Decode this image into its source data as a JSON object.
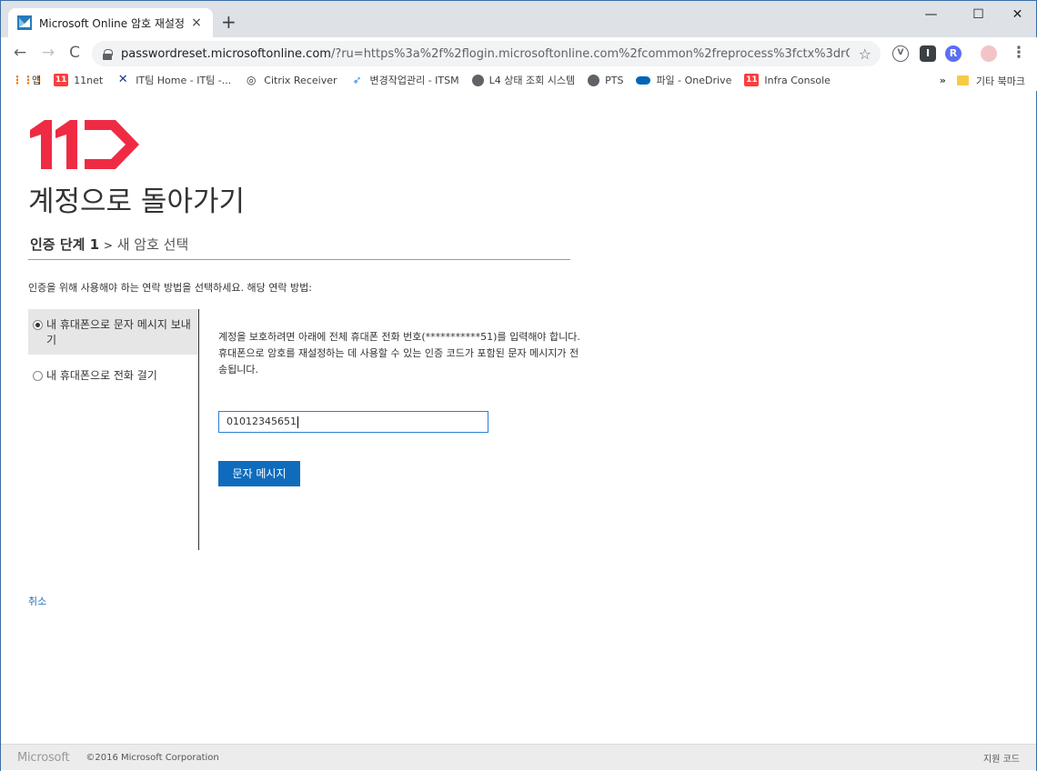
{
  "browser": {
    "tab_title": "Microsoft Online 암호 재설정",
    "tab_close": "×",
    "new_tab": "+",
    "window": {
      "minimize": "—",
      "maximize": "☐",
      "close": "✕"
    },
    "nav": {
      "back": "←",
      "forward": "→",
      "reload": "C"
    },
    "url_host": "passwordreset.microsoftonline.com",
    "url_rest": "/?ru=https%3a%2f%2flogin.microsoftonline.com%2fcommon%2freprocess%3fctx%3drQIIAeNisNLJ...",
    "star": "☆",
    "extensions": [
      "V",
      "I",
      "R"
    ],
    "menu": "⋮",
    "bookmarks": [
      {
        "label": "앱",
        "icon": "apps-grid-icon",
        "color": "#e8710a"
      },
      {
        "label": "11net",
        "icon": "11st-icon",
        "color": "#ff3d3d"
      },
      {
        "label": "IT팀 Home - IT팀 -...",
        "icon": "x-icon",
        "color": "#1a3a8a"
      },
      {
        "label": "Citrix Receiver",
        "icon": "citrix-icon",
        "color": "#333333"
      },
      {
        "label": "변경작업관리 - ITSM",
        "icon": "jira-icon",
        "color": "#2684ff"
      },
      {
        "label": "L4 상태 조회 시스템",
        "icon": "globe-icon",
        "color": "#5f6368"
      },
      {
        "label": "PTS",
        "icon": "globe-icon",
        "color": "#5f6368"
      },
      {
        "label": "파일 - OneDrive",
        "icon": "onedrive-icon",
        "color": "#0364b8"
      },
      {
        "label": "Infra Console",
        "icon": "11st-icon",
        "color": "#ff3d3d"
      }
    ],
    "bookmarks_more": "»",
    "other_bookmarks": "기타 북마크"
  },
  "page": {
    "logo_text": "11",
    "heading": "계정으로 돌아가기",
    "step_label_bold": "인증 단계 1",
    "step_separator": ">",
    "step_next": "새 암호 선택",
    "prompt": "인증을 위해 사용해야 하는 연락 방법을 선택하세요. 해당 연락 방법:",
    "methods": [
      {
        "label": "내 휴대폰으로 문자 메시지 보내기",
        "selected": true
      },
      {
        "label": "내 휴대폰으로 전화 걸기",
        "selected": false
      }
    ],
    "detail_text": "계정을 보호하려면 아래에 전체 휴대폰 전화 번호(***********51)를 입력해야 합니다. 휴대폰으로 암호를 재설정하는 데 사용할 수 있는 인증 코드가 포함된 문자 메시지가 전송됩니다.",
    "phone_value": "01012345651",
    "sms_button": "문자 메시지",
    "cancel_link": "취소"
  },
  "footer": {
    "brand": "Microsoft",
    "copyright": "©2016 Microsoft Corporation",
    "support_code": "지원 코드"
  },
  "colors": {
    "brand_red": "#ef2b44",
    "button_blue": "#0f6cbd",
    "link_blue": "#2b6fb5"
  }
}
